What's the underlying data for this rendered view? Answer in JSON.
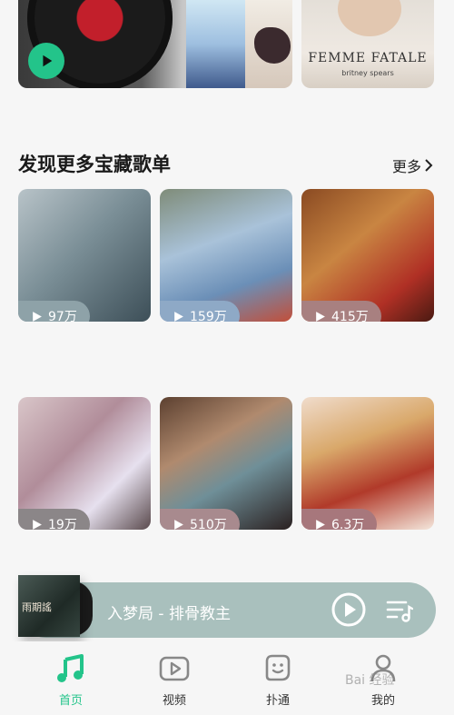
{
  "top_cards": {
    "album_title": "FEMME FATALE",
    "album_artist": "britney spears"
  },
  "section": {
    "title": "发现更多宝藏歌单",
    "more_label": "更多"
  },
  "playlists": [
    {
      "plays": "97万",
      "pill_color": "#8ea2a8"
    },
    {
      "plays": "159万",
      "pill_color": "#8ea9c6"
    },
    {
      "plays": "415万",
      "pill_color": "#a88080"
    },
    {
      "plays": "19万",
      "pill_color": "#8b8688"
    },
    {
      "plays": "510万",
      "pill_color": "#a88a8e"
    },
    {
      "plays": "6.3万",
      "pill_color": "#a7777c"
    }
  ],
  "player": {
    "cover_text": "雨期謠",
    "track": "入梦局 - 排骨教主"
  },
  "nav": [
    {
      "label": "首页",
      "icon": "music-note-icon",
      "active": true
    },
    {
      "label": "视频",
      "icon": "video-play-icon",
      "active": false
    },
    {
      "label": "扑通",
      "icon": "chat-face-icon",
      "active": false
    },
    {
      "label": "我的",
      "icon": "user-icon",
      "active": false
    }
  ],
  "watermark": "Bai 经验",
  "colors": {
    "accent": "#23c48a",
    "player_bg": "#a9c0bd"
  }
}
